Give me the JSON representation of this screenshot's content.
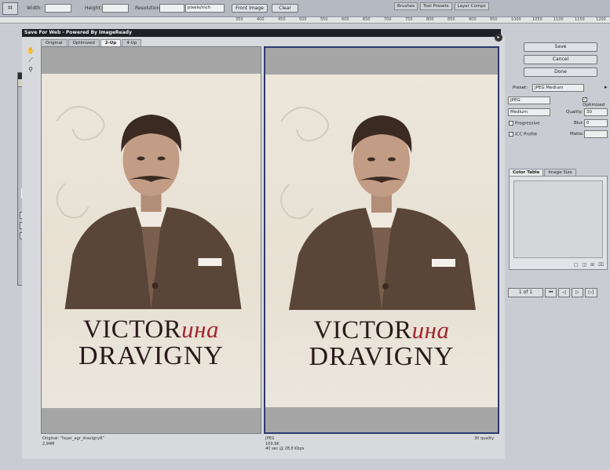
{
  "options_bar": {
    "tool_icon": "crop-icon",
    "width_label": "Width:",
    "height_label": "Height:",
    "resolution_label": "Resolution:",
    "resolution_unit": "pixels/inch",
    "front_image_label": "Front Image",
    "clear_label": "Clear"
  },
  "palette_wells": [
    "Brushes",
    "Tool Presets",
    "Layer Comps"
  ],
  "ruler_ticks": [
    "350",
    "400",
    "450",
    "500",
    "550",
    "600",
    "650",
    "700",
    "750",
    "800",
    "850",
    "900",
    "950",
    "1000",
    "1050",
    "1100",
    "1150",
    "1200"
  ],
  "dialog": {
    "title": "Save For Web - Powered By ImageReady",
    "tabs": [
      "Original",
      "Optimized",
      "2-Up",
      "4-Up"
    ],
    "active_tab": "2-Up"
  },
  "image": {
    "title_line1_latin": "VICTOR",
    "title_line1_cyrillic": "ина",
    "title_line2": "DRAVIGNY",
    "accent_color": "#a3262f"
  },
  "left_pane": {
    "info_line1": "Original: \"fayer_agr_dravigny8\"",
    "info_line2": "2,94M"
  },
  "right_pane": {
    "info_line1": "JPEG",
    "info_line2": "109,9K",
    "info_line3": "40 sec @ 28.8 Kbps",
    "quality_text": "30 quality"
  },
  "side_panel": {
    "save_label": "Save",
    "cancel_label": "Cancel",
    "done_label": "Done",
    "preset_label": "Preset:",
    "preset_value": "JPEG Medium",
    "format_value": "JPEG",
    "optimized_label": "Optimized",
    "quality_level": "Medium",
    "quality_label": "Quality:",
    "quality_value": "30",
    "progressive_label": "Progressive",
    "blur_label": "Blur:",
    "blur_value": "0",
    "icc_label": "ICC Profile",
    "matte_label": "Matte:",
    "color_table_tab": "Color Table",
    "image_size_tab": "Image Size",
    "page_indicator": "1 of 1"
  }
}
